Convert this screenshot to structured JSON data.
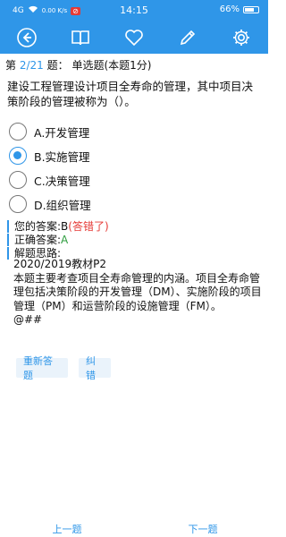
{
  "status_bar": {
    "network": "4G",
    "speed": "0.00 K/s",
    "time": "14:15",
    "battery": "66%"
  },
  "toolbar": {
    "icons": [
      "back-icon",
      "book-icon",
      "heart-icon",
      "pencil-icon",
      "gear-icon"
    ]
  },
  "question": {
    "prefix": "第",
    "progress": "2/21",
    "suffix": "题：",
    "type": "单选题(本题1分)",
    "text": "建设工程管理设计项目全寿命的管理，其中项目决策阶段的管理被称为（）。",
    "options": [
      {
        "label": "A.开发管理",
        "selected": false
      },
      {
        "label": "B.实施管理",
        "selected": true
      },
      {
        "label": "C.决策管理",
        "selected": false
      },
      {
        "label": "D.组织管理",
        "selected": false
      }
    ]
  },
  "result": {
    "your_answer_label": "您的答案:",
    "your_answer_value": "B",
    "wrong_tag": "(答错了)",
    "correct_label": "正确答案:",
    "correct_value": "A",
    "analysis_label": "解题思路:"
  },
  "analysis": {
    "source": "2020/2019教材P2",
    "body": "本题主要考查项目全寿命管理的内涵。项目全寿命管理包括决策阶段的开发管理（DM）、实施阶段的项目管理（PM）和运营阶段的设施管理（FM）。",
    "tail": "@##"
  },
  "actions": {
    "retry": "重新答题",
    "report": "纠错"
  },
  "nav": {
    "prev": "上一题",
    "next": "下一题"
  },
  "colors": {
    "primary": "#2f96e8",
    "wrong": "#e53935",
    "correct": "#2e9d3e"
  }
}
